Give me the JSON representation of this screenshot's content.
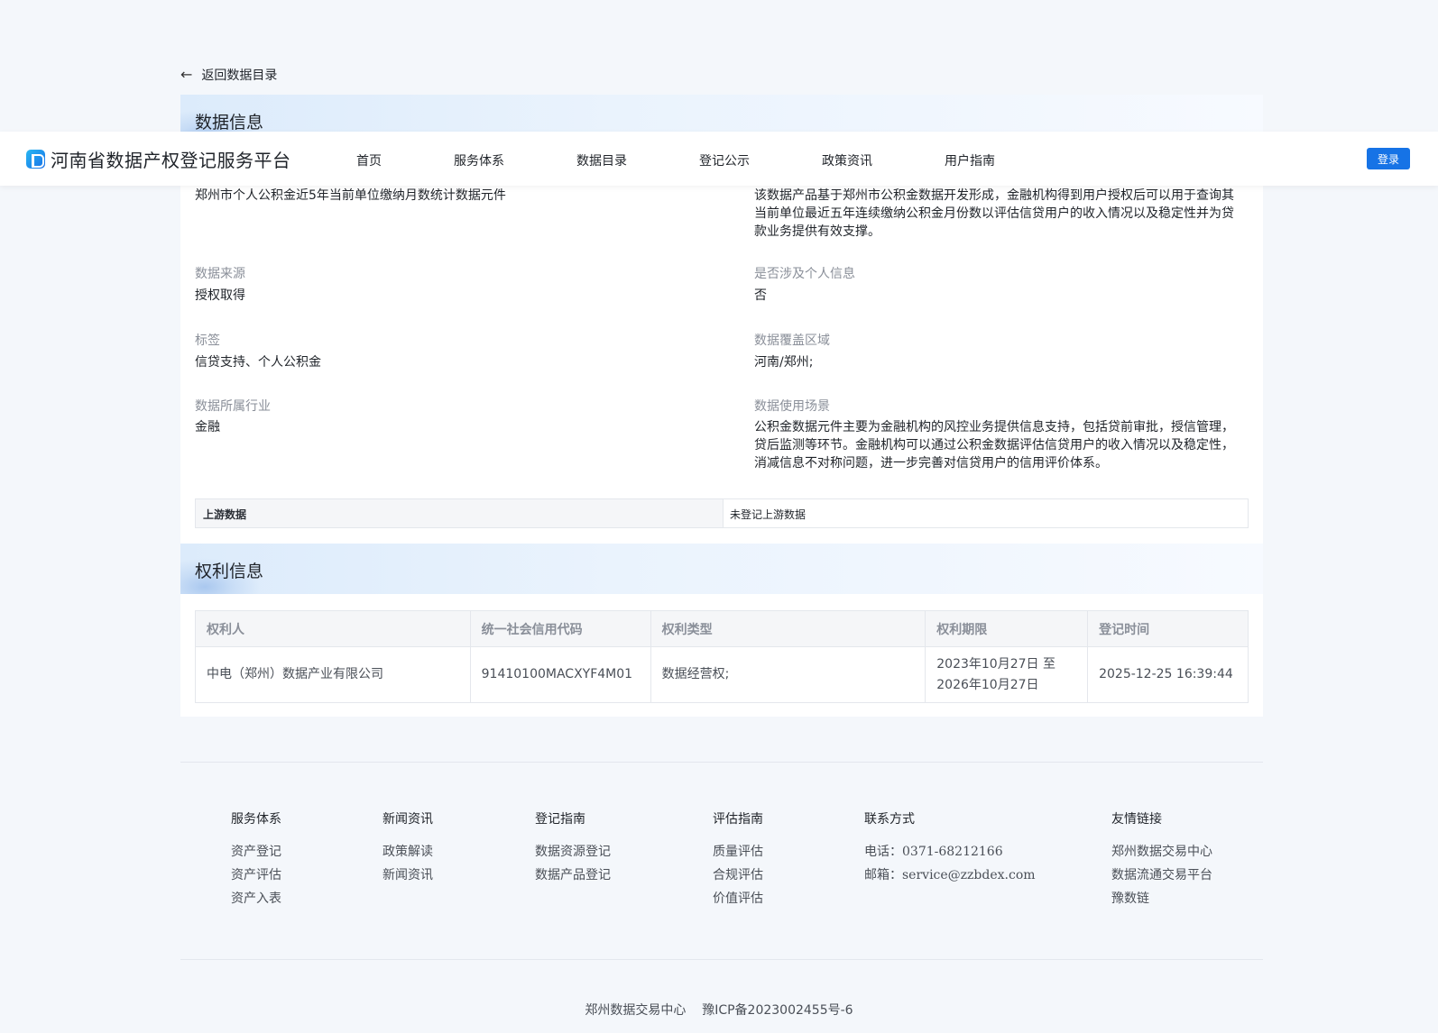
{
  "back_link": {
    "label": "返回数据目录"
  },
  "header": {
    "logo_text": "河南省数据产权登记服务平台",
    "nav": [
      "首页",
      "服务体系",
      "数据目录",
      "登记公示",
      "政策资讯",
      "用户指南"
    ],
    "login_label": "登录"
  },
  "data_info": {
    "section_title": "数据信息",
    "name_value": "郑州市个人公积金近5年当前单位缴纳月数统计数据元件",
    "description_value": "该数据产品基于郑州市公积金数据开发形成，金融机构得到用户授权后可以用于查询其当前单位最近五年连续缴纳公积金月份数以评估信贷用户的收入情况以及稳定性并为贷款业务提供有效支撑。",
    "fields": [
      {
        "label": "数据来源",
        "value": "授权取得"
      },
      {
        "label": "是否涉及个人信息",
        "value": "否"
      },
      {
        "label": "标签",
        "value": "信贷支持、个人公积金"
      },
      {
        "label": "数据覆盖区域",
        "value": "河南/郑州;"
      },
      {
        "label": "数据所属行业",
        "value": "金融"
      },
      {
        "label": "数据使用场景",
        "value": "公积金数据元件主要为金融机构的风控业务提供信息支持，包括贷前审批，授信管理，贷后监测等环节。金融机构可以通过公积金数据评估信贷用户的收入情况以及稳定性，消减信息不对称问题，进一步完善对信贷用户的信用评价体系。"
      }
    ],
    "upstream": {
      "label": "上游数据",
      "value": "未登记上游数据"
    }
  },
  "rights_info": {
    "section_title": "权利信息",
    "columns": [
      "权利人",
      "统一社会信用代码",
      "权利类型",
      "权利期限",
      "登记时间"
    ],
    "rows": [
      {
        "holder": "中电（郑州）数据产业有限公司",
        "credit_code": "91410100MACXYF4M01",
        "type": "数据经营权;",
        "period_start": "2023年10月27日 至",
        "period_end": "2026年10月27日",
        "registered_at": "2025-12-25 16:39:44"
      }
    ]
  },
  "footer": {
    "columns": [
      {
        "title": "服务体系",
        "items": [
          "资产登记",
          "资产评估",
          "资产入表"
        ]
      },
      {
        "title": "新闻资讯",
        "items": [
          "政策解读",
          "新闻资讯"
        ]
      },
      {
        "title": "登记指南",
        "items": [
          "数据资源登记",
          "数据产品登记"
        ]
      },
      {
        "title": "评估指南",
        "items": [
          "质量评估",
          "合规评估",
          "价值评估"
        ]
      },
      {
        "title": "联系方式",
        "items": [
          "电话：0371-68212166",
          "邮箱：service@zzbdex.com"
        ]
      },
      {
        "title": "友情链接",
        "items": [
          "郑州数据交易中心",
          "数据流通交易平台",
          "豫数链"
        ]
      }
    ],
    "copyright_org": "郑州数据交易中心",
    "copyright_icp": "豫ICP备2023002455号-6"
  }
}
